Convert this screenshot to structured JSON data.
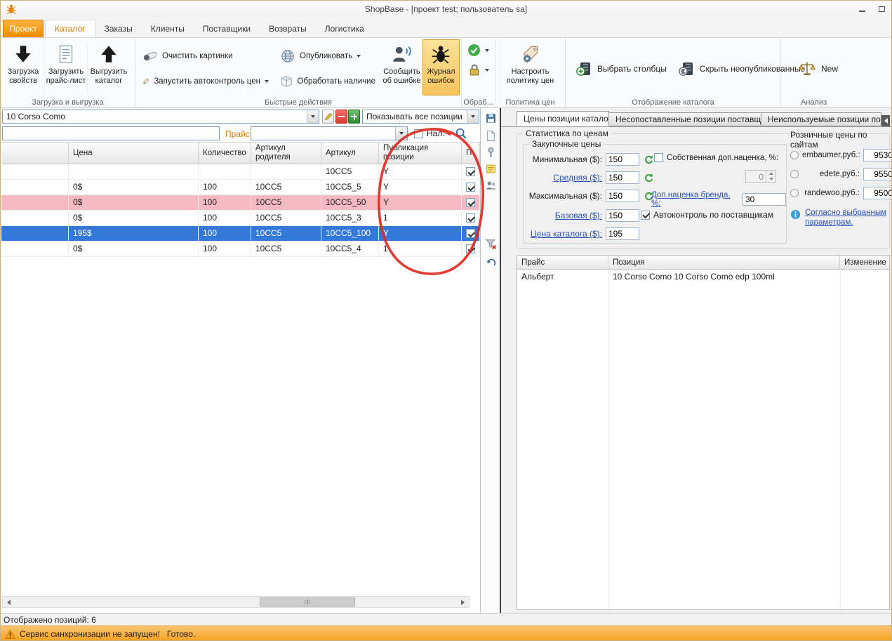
{
  "window": {
    "title": "ShopBase - [проект test; пользователь sa]"
  },
  "nav": {
    "project": "Проект",
    "tabs": [
      {
        "label": "Каталог"
      },
      {
        "label": "Заказы"
      },
      {
        "label": "Клиенты"
      },
      {
        "label": "Поставщики"
      },
      {
        "label": "Возвраты"
      },
      {
        "label": "Логистика"
      }
    ]
  },
  "ribbon": {
    "load_group": {
      "label": "Загрузка и выгрузка",
      "load_props": "Загрузка свойств",
      "load_pricelist": "Загрузить прайс-лист",
      "export_catalog": "Выгрузить каталог"
    },
    "quick_group": {
      "label": "Быстрые действия",
      "clear_images": "Очистить картинки",
      "run_autocontrol": "Запустить автоконтроль цен",
      "publish": "Опубликовать",
      "process_stock": "Обработать наличие",
      "report_error": "Сообщить об ошибке",
      "error_log": "Журнал ошибок"
    },
    "process_group": {
      "label": "Обраб..."
    },
    "policy_group": {
      "label": "Политика цен",
      "configure_policy": "Настроить политику цен"
    },
    "display_group": {
      "label": "Отображение каталога",
      "choose_columns": "Выбрать столбцы",
      "hide_unpublished": "Скрыть неопубликованные"
    },
    "analysis_group": {
      "label": "Анализ",
      "new_btn": "New"
    }
  },
  "left": {
    "brand_combo": "10 Corso Como",
    "show_combo": "Показывать все позиции",
    "price_label": "Прайс",
    "cash_checkbox": "Нал.",
    "status": "Отображено позиций: 6",
    "table": {
      "columns": [
        "",
        "Цена",
        "Количество",
        "Артикул родителя",
        "Артикул",
        "Публикация позиции",
        "П"
      ],
      "rows": [
        {
          "price": "",
          "qty": "",
          "parent": "",
          "sku": "10CC5",
          "pub": "Y"
        },
        {
          "price": "0$",
          "qty": "100",
          "parent": "10CC5",
          "sku": "10CC5_5",
          "pub": "Y"
        },
        {
          "price": "0$",
          "qty": "100",
          "parent": "10CC5",
          "sku": "10CC5_50",
          "pub": "Y"
        },
        {
          "price": "0$",
          "qty": "100",
          "parent": "10CC5",
          "sku": "10CC5_3",
          "pub": "1"
        },
        {
          "price": "195$",
          "qty": "100",
          "parent": "10CC5",
          "sku": "10CC5_100",
          "pub": "Y"
        },
        {
          "price": "0$",
          "qty": "100",
          "parent": "10CC5",
          "sku": "10CC5_4",
          "pub": "1"
        }
      ]
    }
  },
  "right": {
    "tabs": [
      {
        "label": "Цены позиции каталога"
      },
      {
        "label": "Несопоставленные позиции поставщиков"
      },
      {
        "label": "Неиспользуемые позиции поста"
      }
    ],
    "stats": {
      "title": "Статистика по ценам",
      "purchase_title": "Закупочные цены",
      "min_label": "Минимальная ($):",
      "min_value": "150",
      "avg_label": "Средняя ($):",
      "avg_value": "150",
      "max_label": "Максимальная ($):",
      "max_value": "150",
      "base_label": "Базовая ($):",
      "base_value": "150",
      "catalog_label": "Цена каталога ($):",
      "catalog_value": "195",
      "own_markup_label": "Собственная доп.наценка, %:",
      "own_markup_value": "0",
      "brand_markup_label": "Доп.наценка бренда, %:",
      "brand_markup_value": "30",
      "autocontrol_label": "Автоконтроль по поставщикам",
      "retail_title": "Розничные цены по сайтам",
      "sites": [
        {
          "label": "embaumer,руб.:",
          "value": "9530"
        },
        {
          "label": "edete,руб.:",
          "value": "9550"
        },
        {
          "label": "randewoo,руб.:",
          "value": "9500"
        }
      ],
      "note": "Согласно выбранным параметрам."
    },
    "price_table": {
      "columns": [
        "Прайс",
        "Позиция",
        "Изменение"
      ],
      "rows": [
        {
          "name": "Альберт",
          "position": "10 Corso Como 10 Corso Como edp 100ml",
          "change": ""
        }
      ]
    }
  },
  "statusbar": {
    "warning": "Сервис синхронизации не запущен!",
    "ready": "Готово."
  }
}
